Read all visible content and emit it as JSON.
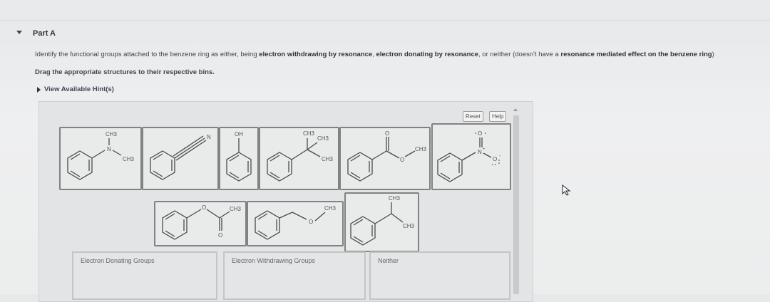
{
  "part": {
    "label": "Part A",
    "toggle_icon": "caret-down-icon"
  },
  "instructions": {
    "text_1": "Identify the functional groups attached to the benzene ring as either, being ",
    "bold_1": "electron withdrawing by resonance",
    "text_2": ", ",
    "bold_2": "electron donating by resonance",
    "text_3": ", or neither (doesn't have a ",
    "bold_3": "resonance mediated effect on the benzene ring",
    "text_4": ")"
  },
  "drag_text": "Drag the appropriate structures to their respective bins.",
  "hint": {
    "label": "View Available Hint(s)"
  },
  "toolbar": {
    "reset_label": "Reset",
    "help_label": "Help"
  },
  "structures": [
    {
      "id": "dimethylaminobenzene",
      "labels": {
        "ch3_top": "CH3",
        "n": "N",
        "ch3_right": "CH3"
      }
    },
    {
      "id": "benzonitrile",
      "labels": {
        "n": "N"
      }
    },
    {
      "id": "phenol",
      "labels": {
        "oh": "OH"
      }
    },
    {
      "id": "tert-butylbenzene",
      "labels": {
        "ch3_a": "CH3",
        "ch3_b": "CH3",
        "ch3_c": "CH3"
      }
    },
    {
      "id": "methyl-benzoate",
      "labels": {
        "o_top": "O",
        "o_ester": "O",
        "ch3": "CH3"
      }
    },
    {
      "id": "nitrobenzene",
      "labels": {
        "o_top": "O",
        "n": "N",
        "plus": "+",
        "o_right": "O",
        "minus": "-"
      }
    },
    {
      "id": "phenyl-acetate",
      "labels": {
        "o_ester": "O",
        "o_bottom": "O",
        "ch3": "CH3"
      }
    },
    {
      "id": "benzyl-methyl-ether",
      "labels": {
        "o": "O",
        "ch3": "CH3"
      }
    },
    {
      "id": "isopropylbenzene",
      "labels": {
        "ch3_top": "CH3",
        "ch3_right": "CH3"
      }
    }
  ],
  "bins": [
    {
      "label": "Electron Donating Groups"
    },
    {
      "label": "Electron Withdrawing Groups"
    },
    {
      "label": "Neither"
    }
  ]
}
